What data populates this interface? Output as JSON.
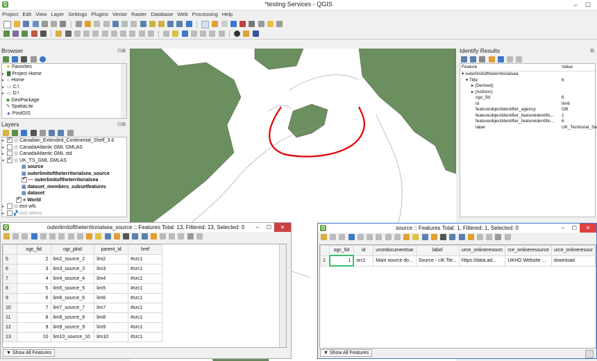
{
  "window": {
    "title": "*testing Services - QGIS",
    "min": "–",
    "max": "☐"
  },
  "menu": [
    "Project",
    "Edit",
    "View",
    "Layer",
    "Settings",
    "Plugins",
    "Vector",
    "Raster",
    "Database",
    "Web",
    "Processing",
    "Help"
  ],
  "browser": {
    "title": "Browser",
    "items": [
      "Favorites",
      "Project Home",
      "Home",
      "C:\\",
      "D:\\",
      "GeoPackage",
      "SpatiaLite",
      "PostGIS"
    ]
  },
  "layers": {
    "title": "Layers",
    "items": [
      {
        "label": "Canadian_Extended_Continental_Shelf_3.6",
        "checked": true
      },
      {
        "label": "CanadaAtlantic GML GMLAS",
        "checked": false
      },
      {
        "label": "CanadaAtlantic GML std",
        "checked": false
      },
      {
        "label": "UK_TS_GML GMLAS",
        "checked": true
      },
      {
        "label": "source",
        "checked": null
      },
      {
        "label": "outerlimitoftheterritorialsea_source",
        "checked": null
      },
      {
        "label": "outerlimitoftheterritorialsea",
        "checked": true
      },
      {
        "label": "dataset_members_subsetfeatures",
        "checked": null
      },
      {
        "label": "dataset",
        "checked": null
      },
      {
        "label": "World",
        "checked": true
      },
      {
        "label": "esri wfs",
        "checked": false
      },
      {
        "label": "vsct wmns",
        "checked": false
      }
    ]
  },
  "identify": {
    "title": "Identify Results",
    "col_feature": "Feature",
    "col_value": "Value",
    "rows": [
      {
        "f": "outerlimitoftheterritorialsea",
        "v": "",
        "indent": 0
      },
      {
        "f": "Title",
        "v": "6",
        "indent": 1
      },
      {
        "f": "(Derived)",
        "v": "",
        "indent": 2
      },
      {
        "f": "(Actions)",
        "v": "",
        "indent": 2
      },
      {
        "f": "ogc_fid",
        "v": "6",
        "indent": 2
      },
      {
        "f": "id",
        "v": "lim6",
        "indent": 2
      },
      {
        "f": "featureobjectidentifier_agency",
        "v": "GB",
        "indent": 2
      },
      {
        "f": "featureobjectidentifier_featureidentific...",
        "v": "1",
        "indent": 2
      },
      {
        "f": "featureobjectidentifier_featureidentific...",
        "v": "6",
        "indent": 2
      },
      {
        "f": "label",
        "v": "UK_Territorial_Sea_...",
        "indent": 2
      }
    ]
  },
  "table1": {
    "title": "outerlimitoftheterritorialsea_source :: Features Total: 13, Filtered: 13, Selected: 0",
    "headers": [
      "ogc_fid",
      "ogr_pkid",
      "parent_id",
      "href"
    ],
    "rows": [
      {
        "n": "5",
        "c": [
          "2",
          "lim2_source_2",
          "lim2",
          "#src1"
        ]
      },
      {
        "n": "6",
        "c": [
          "3",
          "lim3_source_3",
          "lim3",
          "#src1"
        ]
      },
      {
        "n": "7",
        "c": [
          "4",
          "lim4_source_4",
          "lim4",
          "#src1"
        ]
      },
      {
        "n": "8",
        "c": [
          "5",
          "lim5_source_5",
          "lim5",
          "#src1"
        ]
      },
      {
        "n": "9",
        "c": [
          "6",
          "lim6_source_6",
          "lim6",
          "#src1"
        ]
      },
      {
        "n": "10",
        "c": [
          "7",
          "lim7_source_7",
          "lim7",
          "#src1"
        ]
      },
      {
        "n": "11",
        "c": [
          "8",
          "lim8_source_8",
          "lim8",
          "#src1"
        ]
      },
      {
        "n": "12",
        "c": [
          "9",
          "lim9_source_9",
          "lim9",
          "#src1"
        ]
      },
      {
        "n": "13",
        "c": [
          "10",
          "lim10_source_10",
          "lim10",
          "#src1"
        ]
      }
    ],
    "show_all": "Show All Features"
  },
  "table2": {
    "title": "source :: Features Total: 1, Filtered: 1, Selected: 0",
    "headers": [
      "ogc_fid",
      "id",
      "urcedocumentnar",
      "label",
      "urce_onlineresourc",
      "rce_onlineresource",
      "urce_onlineresour"
    ],
    "rows": [
      {
        "n": "1",
        "c": [
          "1",
          "src1",
          "Main source do...",
          "Source - UK Ter...",
          "https://data.ad...",
          "UKHO Website ...",
          "download"
        ]
      }
    ],
    "show_all": "Show All Features"
  },
  "colors": {
    "land": "#6b8f5e",
    "selection": "#e00000",
    "accent": "#3c78c8"
  }
}
